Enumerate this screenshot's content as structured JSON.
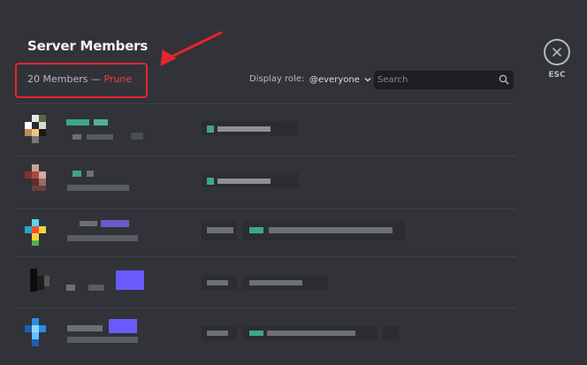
{
  "header": {
    "title": "Server Members",
    "member_count": "20 Members",
    "separator": "—",
    "prune_label": "Prune"
  },
  "filters": {
    "display_role_label": "Display role:",
    "role_value": "@everyone",
    "search_placeholder": "Search"
  },
  "close": {
    "label": "ESC"
  },
  "colors": {
    "accent_red": "#f23f42",
    "annotation_red": "#e4262b",
    "background": "#313338"
  },
  "icons": [
    "search-icon",
    "chevron-down-icon",
    "close-icon",
    "annotation-arrow-icon"
  ]
}
